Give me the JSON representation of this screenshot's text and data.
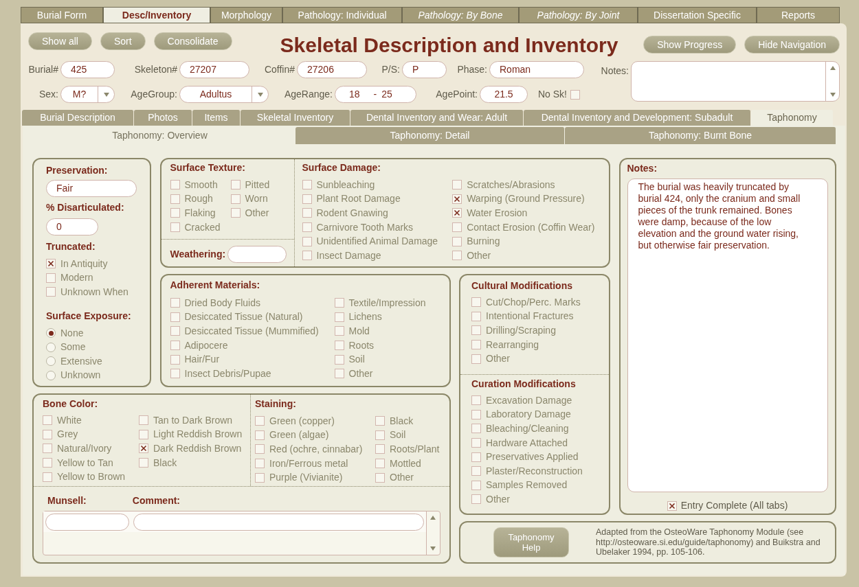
{
  "top_tabs": [
    {
      "label": "Burial Form",
      "selected": false,
      "italic": false
    },
    {
      "label": "Desc/Inventory",
      "selected": true,
      "italic": false
    },
    {
      "label": "Morphology",
      "selected": false,
      "italic": false
    },
    {
      "label": "Pathology: Individual",
      "selected": false,
      "italic": false
    },
    {
      "label": "Pathology: By Bone",
      "selected": false,
      "italic": true
    },
    {
      "label": "Pathology: By Joint",
      "selected": false,
      "italic": true
    },
    {
      "label": "Dissertation Specific",
      "selected": false,
      "italic": false
    },
    {
      "label": "Reports",
      "selected": false,
      "italic": false
    }
  ],
  "toolbar": {
    "left_buttons": [
      "Show all",
      "Sort",
      "Consolidate"
    ],
    "title": "Skeletal Description and Inventory",
    "right_buttons": [
      "Show Progress",
      "Hide Navigation"
    ]
  },
  "record_fields": [
    {
      "label": "Burial#",
      "value": "425"
    },
    {
      "label": "Skeleton#",
      "value": "27207"
    },
    {
      "label": "Coffin#",
      "value": "27206"
    },
    {
      "label": "P/S:",
      "value": "P"
    },
    {
      "label": "Phase:",
      "value": "Roman"
    }
  ],
  "record_fields_2": [
    {
      "kind": "dropdown",
      "label": "Sex:",
      "value": "M?"
    },
    {
      "kind": "dropdown",
      "label": "AgeGroup:",
      "value": "Adultus"
    },
    {
      "kind": "range",
      "label": "AgeRange:",
      "from": "18",
      "separator": "-",
      "to": "25"
    },
    {
      "kind": "text",
      "label": "AgePoint:",
      "value": "21.5"
    },
    {
      "kind": "checkbox",
      "label": "No Sk!",
      "checked": false
    }
  ],
  "record_notes": {
    "label": "Notes:"
  },
  "section_tabs": [
    {
      "label": "Burial Description",
      "selected": false
    },
    {
      "label": "Photos",
      "selected": false
    },
    {
      "label": "Items",
      "selected": false
    },
    {
      "label": "Skeletal Inventory",
      "selected": false
    },
    {
      "label": "Dental Inventory and Wear: Adult",
      "selected": false
    },
    {
      "label": "Dental Inventory and Development: Subadult",
      "selected": false
    },
    {
      "label": "Taphonomy",
      "selected": true
    }
  ],
  "sub_tabs": [
    {
      "label": "Taphonomy: Overview",
      "selected": true
    },
    {
      "label": "Taphonomy: Detail",
      "selected": false
    },
    {
      "label": "Taphonomy: Burnt Bone",
      "selected": false
    }
  ],
  "preservation": {
    "title": "Preservation:",
    "value": "Fair"
  },
  "disarticulated": {
    "title": "% Disarticulated:",
    "value": "0"
  },
  "truncated": {
    "title": "Truncated:",
    "options": [
      {
        "label": "In Antiquity",
        "checked": true
      },
      {
        "label": "Modern",
        "checked": false
      },
      {
        "label": "Unknown When",
        "checked": false
      }
    ]
  },
  "surface_exposure": {
    "title": "Surface Exposure:",
    "options": [
      {
        "label": "None",
        "selected": true
      },
      {
        "label": "Some",
        "selected": false
      },
      {
        "label": "Extensive",
        "selected": false
      },
      {
        "label": "Unknown",
        "selected": false
      }
    ]
  },
  "surface_texture": {
    "title": "Surface Texture:",
    "options": [
      {
        "label": "Smooth",
        "checked": false
      },
      {
        "label": "Pitted",
        "checked": false
      },
      {
        "label": "Rough",
        "checked": false
      },
      {
        "label": "Worn",
        "checked": false
      },
      {
        "label": "Flaking",
        "checked": false
      },
      {
        "label": "Other",
        "checked": false
      },
      {
        "label": "Cracked",
        "checked": false
      }
    ]
  },
  "weathering": {
    "label": "Weathering:"
  },
  "surface_damage": {
    "title": "Surface Damage:",
    "columns": [
      [
        {
          "label": "Sunbleaching",
          "checked": false
        },
        {
          "label": "Plant Root Damage",
          "checked": false
        },
        {
          "label": "Rodent Gnawing",
          "checked": false
        },
        {
          "label": "Carnivore Tooth Marks",
          "checked": false
        },
        {
          "label": "Unidentified Animal Damage",
          "checked": false
        },
        {
          "label": "Insect Damage",
          "checked": false
        }
      ],
      [
        {
          "label": "Scratches/Abrasions",
          "checked": false
        },
        {
          "label": "Warping (Ground Pressure)",
          "checked": true
        },
        {
          "label": "Water Erosion",
          "checked": true
        },
        {
          "label": "Contact Erosion (Coffin Wear)",
          "checked": false
        },
        {
          "label": "Burning",
          "checked": false
        },
        {
          "label": "Other",
          "checked": false
        }
      ]
    ]
  },
  "adherent_materials": {
    "title": "Adherent Materials:",
    "columns": [
      [
        {
          "label": "Dried Body Fluids",
          "checked": false
        },
        {
          "label": "Desiccated Tissue (Natural)",
          "checked": false
        },
        {
          "label": "Desiccated Tissue (Mummified)",
          "checked": false
        },
        {
          "label": "Adipocere",
          "checked": false
        },
        {
          "label": "Hair/Fur",
          "checked": false
        },
        {
          "label": "Insect Debris/Pupae",
          "checked": false
        }
      ],
      [
        {
          "label": "Textile/Impression",
          "checked": false
        },
        {
          "label": "Lichens",
          "checked": false
        },
        {
          "label": "Mold",
          "checked": false
        },
        {
          "label": "Roots",
          "checked": false
        },
        {
          "label": "Soil",
          "checked": false
        },
        {
          "label": "Other",
          "checked": false
        }
      ]
    ]
  },
  "cultural_modifications": {
    "title": "Cultural Modifications",
    "options": [
      {
        "label": "Cut/Chop/Perc. Marks",
        "checked": false
      },
      {
        "label": "Intentional Fractures",
        "checked": false
      },
      {
        "label": "Drilling/Scraping",
        "checked": false
      },
      {
        "label": "Rearranging",
        "checked": false
      },
      {
        "label": "Other",
        "checked": false
      }
    ]
  },
  "curation_modifications": {
    "title": "Curation Modifications",
    "options": [
      {
        "label": "Excavation Damage",
        "checked": false
      },
      {
        "label": "Laboratory Damage",
        "checked": false
      },
      {
        "label": "Bleaching/Cleaning",
        "checked": false
      },
      {
        "label": "Hardware Attached",
        "checked": false
      },
      {
        "label": "Preservatives Applied",
        "checked": false
      },
      {
        "label": "Plaster/Reconstruction",
        "checked": false
      },
      {
        "label": "Samples Removed",
        "checked": false
      },
      {
        "label": "Other",
        "checked": false
      }
    ]
  },
  "bone_color": {
    "title": "Bone Color:",
    "columns": [
      [
        {
          "label": "White",
          "checked": false
        },
        {
          "label": "Grey",
          "checked": false
        },
        {
          "label": "Natural/Ivory",
          "checked": false
        },
        {
          "label": "Yellow to Tan",
          "checked": false
        },
        {
          "label": "Yellow to Brown",
          "checked": false
        }
      ],
      [
        {
          "label": "Tan to Dark Brown",
          "checked": false
        },
        {
          "label": "Light Reddish Brown",
          "checked": false
        },
        {
          "label": "Dark Reddish Brown",
          "checked": true
        },
        {
          "label": "Black",
          "checked": false
        }
      ]
    ]
  },
  "staining": {
    "title": "Staining:",
    "columns": [
      [
        {
          "label": "Green (copper)",
          "checked": false
        },
        {
          "label": "Green (algae)",
          "checked": false
        },
        {
          "label": "Red (ochre, cinnabar)",
          "checked": false
        },
        {
          "label": "Iron/Ferrous metal",
          "checked": false
        },
        {
          "label": "Purple (Vivianite)",
          "checked": false
        }
      ],
      [
        {
          "label": "Black",
          "checked": false
        },
        {
          "label": "Soil",
          "checked": false
        },
        {
          "label": "Roots/Plant",
          "checked": false
        },
        {
          "label": "Mottled",
          "checked": false
        },
        {
          "label": "Other",
          "checked": false
        }
      ]
    ]
  },
  "munsell": {
    "label": "Munsell:"
  },
  "comment": {
    "label": "Comment:"
  },
  "notes": {
    "title": "Notes:",
    "text": "The burial was heavily truncated by burial 424, only the cranium and small pieces of the trunk remained. Bones were damp, because of the low elevation and the ground water rising, but otherwise fair preservation.",
    "entry_complete": {
      "label": "Entry Complete (All tabs)",
      "checked": true
    }
  },
  "help": {
    "button": "Taphonomy Help",
    "text": "Adapted from the OsteoWare Taphonomy Module (see http://osteoware.si.edu/guide/taphonomy) and Buikstra and Ubelaker 1994, pp. 105-106."
  }
}
